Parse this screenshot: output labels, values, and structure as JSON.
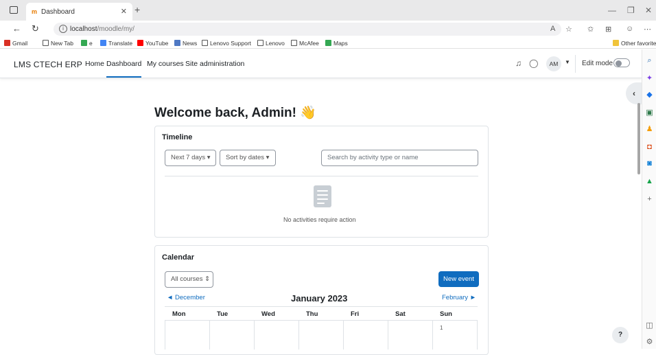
{
  "browser": {
    "tab_title": "Dashboard",
    "tab_favicon": "moodle-icon",
    "url_host": "localhost",
    "url_path": "/moodle/my/",
    "bookmarks": [
      {
        "label": "Gmail",
        "color": "#d93025"
      },
      {
        "label": "New Tab",
        "color": "#ffffff"
      },
      {
        "label": "e",
        "color": "#34a853"
      },
      {
        "label": "Translate",
        "color": "#4285f4"
      },
      {
        "label": "YouTube",
        "color": "#ff0000"
      },
      {
        "label": "News",
        "color": "#4f79c4"
      },
      {
        "label": "Lenovo Support",
        "color": "#ffffff"
      },
      {
        "label": "Lenovo",
        "color": "#ffffff"
      },
      {
        "label": "McAfee",
        "color": "#ffffff"
      },
      {
        "label": "Maps",
        "color": "#34a853"
      }
    ],
    "other_favorites": "Other favorites"
  },
  "navbar": {
    "brand": "LMS CTECH ERP",
    "links": [
      "Home",
      "Dashboard",
      "My courses",
      "Site administration"
    ],
    "active_link": "Dashboard",
    "avatar_initials": "AM",
    "edit_mode_label": "Edit mode",
    "edit_mode_on": false
  },
  "page": {
    "welcome": "Welcome back, Admin! 👋"
  },
  "timeline": {
    "title": "Timeline",
    "filter_days": "Next 7 days ▾",
    "sort": "Sort by dates ▾",
    "search_placeholder": "Search by activity type or name",
    "empty_message": "No activities require action"
  },
  "calendar": {
    "title": "Calendar",
    "course_filter": "All courses ⇕",
    "new_event": "New event",
    "prev_month": "◄ December",
    "month": "January 2023",
    "next_month": "February ►",
    "weekdays": [
      "Mon",
      "Tue",
      "Wed",
      "Thu",
      "Fri",
      "Sat",
      "Sun"
    ],
    "first_day": "1"
  },
  "help_label": "?",
  "colors": {
    "accent": "#0f6cbf",
    "border": "#dee2e6"
  }
}
